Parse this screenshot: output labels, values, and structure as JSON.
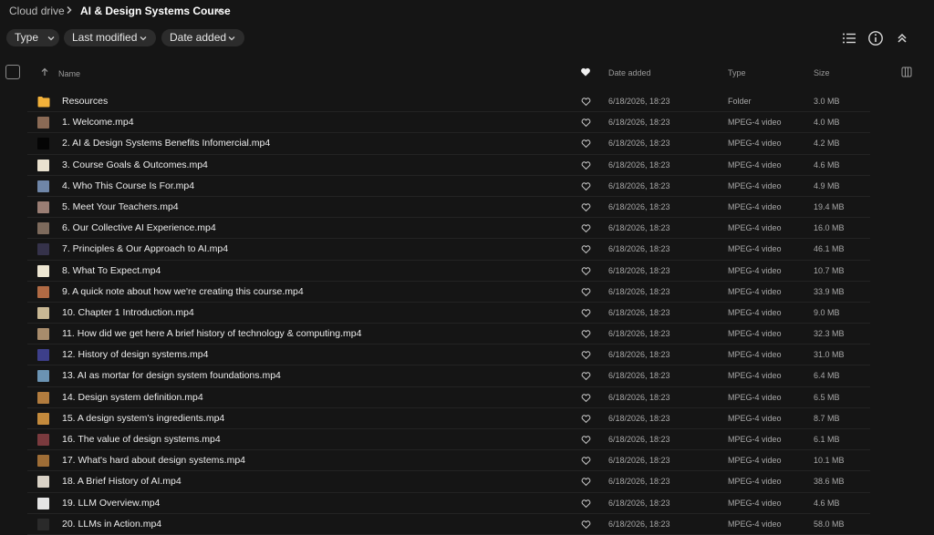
{
  "breadcrumb": {
    "root": "Cloud drive",
    "current": "AI & Design Systems Course"
  },
  "filters": [
    {
      "label": "Type"
    },
    {
      "label": "Last modified"
    },
    {
      "label": "Date added"
    }
  ],
  "columns": {
    "name": "Name",
    "date_added": "Date added",
    "type": "Type",
    "size": "Size"
  },
  "files": [
    {
      "name": "Resources",
      "date": "6/18/2026, 18:23",
      "type": "Folder",
      "size": "3.0 MB",
      "thumb": "#f2b13a",
      "icon": "folder-icon"
    },
    {
      "name": "1. Welcome.mp4",
      "date": "6/18/2026, 18:23",
      "type": "MPEG-4 video",
      "size": "4.0 MB",
      "thumb": "#8a6a55",
      "icon": "video-thumbnail"
    },
    {
      "name": "2. AI & Design Systems Benefits Infomercial.mp4",
      "date": "6/18/2026, 18:23",
      "type": "MPEG-4 video",
      "size": "4.2 MB",
      "thumb": "#050505",
      "icon": "video-thumbnail"
    },
    {
      "name": "3. Course Goals & Outcomes.mp4",
      "date": "6/18/2026, 18:23",
      "type": "MPEG-4 video",
      "size": "4.6 MB",
      "thumb": "#e9e1cf",
      "icon": "video-thumbnail"
    },
    {
      "name": "4. Who This Course Is For.mp4",
      "date": "6/18/2026, 18:23",
      "type": "MPEG-4 video",
      "size": "4.9 MB",
      "thumb": "#6f86a8",
      "icon": "video-thumbnail"
    },
    {
      "name": "5. Meet Your Teachers.mp4",
      "date": "6/18/2026, 18:23",
      "type": "MPEG-4 video",
      "size": "19.4 MB",
      "thumb": "#9a7e74",
      "icon": "video-thumbnail"
    },
    {
      "name": "6. Our Collective AI Experience.mp4",
      "date": "6/18/2026, 18:23",
      "type": "MPEG-4 video",
      "size": "16.0 MB",
      "thumb": "#7d6a5c",
      "icon": "video-thumbnail"
    },
    {
      "name": "7. Principles & Our Approach to AI.mp4",
      "date": "6/18/2026, 18:23",
      "type": "MPEG-4 video",
      "size": "46.1 MB",
      "thumb": "#35324a",
      "icon": "video-thumbnail"
    },
    {
      "name": "8. What To Expect.mp4",
      "date": "6/18/2026, 18:23",
      "type": "MPEG-4 video",
      "size": "10.7 MB",
      "thumb": "#ede6d2",
      "icon": "video-thumbnail"
    },
    {
      "name": "9. A quick note about how we're creating this course.mp4",
      "date": "6/18/2026, 18:23",
      "type": "MPEG-4 video",
      "size": "33.9 MB",
      "thumb": "#b06a44",
      "icon": "video-thumbnail"
    },
    {
      "name": "10. Chapter 1 Introduction.mp4",
      "date": "6/18/2026, 18:23",
      "type": "MPEG-4 video",
      "size": "9.0 MB",
      "thumb": "#c9b894",
      "icon": "video-thumbnail"
    },
    {
      "name": "11. How did we get here A brief history of technology & computing.mp4",
      "date": "6/18/2026, 18:23",
      "type": "MPEG-4 video",
      "size": "32.3 MB",
      "thumb": "#a88c6c",
      "icon": "video-thumbnail"
    },
    {
      "name": "12. History of design systems.mp4",
      "date": "6/18/2026, 18:23",
      "type": "MPEG-4 video",
      "size": "31.0 MB",
      "thumb": "#3d3f8a",
      "icon": "video-thumbnail"
    },
    {
      "name": "13. AI as mortar for design system foundations.mp4",
      "date": "6/18/2026, 18:23",
      "type": "MPEG-4 video",
      "size": "6.4 MB",
      "thumb": "#6b93b3",
      "icon": "video-thumbnail"
    },
    {
      "name": "14. Design system definition.mp4",
      "date": "6/18/2026, 18:23",
      "type": "MPEG-4 video",
      "size": "6.5 MB",
      "thumb": "#b27c3e",
      "icon": "video-thumbnail"
    },
    {
      "name": "15. A design system's ingredients.mp4",
      "date": "6/18/2026, 18:23",
      "type": "MPEG-4 video",
      "size": "8.7 MB",
      "thumb": "#c48a3c",
      "icon": "video-thumbnail"
    },
    {
      "name": "16. The value of design systems.mp4",
      "date": "6/18/2026, 18:23",
      "type": "MPEG-4 video",
      "size": "6.1 MB",
      "thumb": "#7a3a3e",
      "icon": "video-thumbnail"
    },
    {
      "name": "17. What's hard about design systems.mp4",
      "date": "6/18/2026, 18:23",
      "type": "MPEG-4 video",
      "size": "10.1 MB",
      "thumb": "#9e6d36",
      "icon": "video-thumbnail"
    },
    {
      "name": "18. A Brief History of AI.mp4",
      "date": "6/18/2026, 18:23",
      "type": "MPEG-4 video",
      "size": "38.6 MB",
      "thumb": "#d9d2c6",
      "icon": "video-thumbnail"
    },
    {
      "name": "19. LLM Overview.mp4",
      "date": "6/18/2026, 18:23",
      "type": "MPEG-4 video",
      "size": "4.6 MB",
      "thumb": "#e4e4e4",
      "icon": "video-thumbnail"
    },
    {
      "name": "20. LLMs in Action.mp4",
      "date": "6/18/2026, 18:23",
      "type": "MPEG-4 video",
      "size": "58.0 MB",
      "thumb": "#2a2a2a",
      "icon": "video-thumbnail"
    }
  ]
}
